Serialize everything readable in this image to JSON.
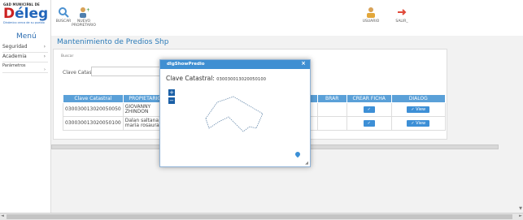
{
  "logo": {
    "top_text": "GAD MUNICIPAL DE",
    "word_first": "D",
    "word_rest": "éleg",
    "subtitle": "Dinámico cerca de su pueblo"
  },
  "sidebar": {
    "menu_title": "Menú",
    "items": [
      {
        "label": "Seguridad"
      },
      {
        "label": "Academia"
      },
      {
        "label": "Parámetros"
      }
    ]
  },
  "toolbar": {
    "buscar": "BUSCAR",
    "nuevo_line1": "NUEVO",
    "nuevo_line2": "PROPIETARIO",
    "usuario": "USUARIO",
    "salir": "SALIR_"
  },
  "form": {
    "title": "Mantenimiento de Predios Shp",
    "panel_caption": "Buscar",
    "clave_label": "Clave Catastral:",
    "clave_value": ""
  },
  "table": {
    "headers": [
      "Clave Catastral",
      "PROPIETARIO",
      "",
      "",
      "BRAR",
      "CREAR FICHA",
      "DIALOG"
    ],
    "rows": [
      {
        "clave": "030030013020050050",
        "propietario": "GIOVANNY ZHINDON",
        "check": "✓",
        "view": "View"
      },
      {
        "clave": "030030013020050100",
        "propietario": "Dalan saltana maria rosaura",
        "check": "✓",
        "view": "View"
      }
    ]
  },
  "dialog": {
    "title": "dlgShowPredio",
    "close": "×",
    "clave_label": "Clave Catastral:",
    "clave_value": "030030013020050100",
    "zoom_in": "+",
    "zoom_out": "−"
  },
  "colors": {
    "accent": "#3f8fd2",
    "header_blue": "#5aa0d8",
    "title_blue": "#2b7ab8"
  }
}
